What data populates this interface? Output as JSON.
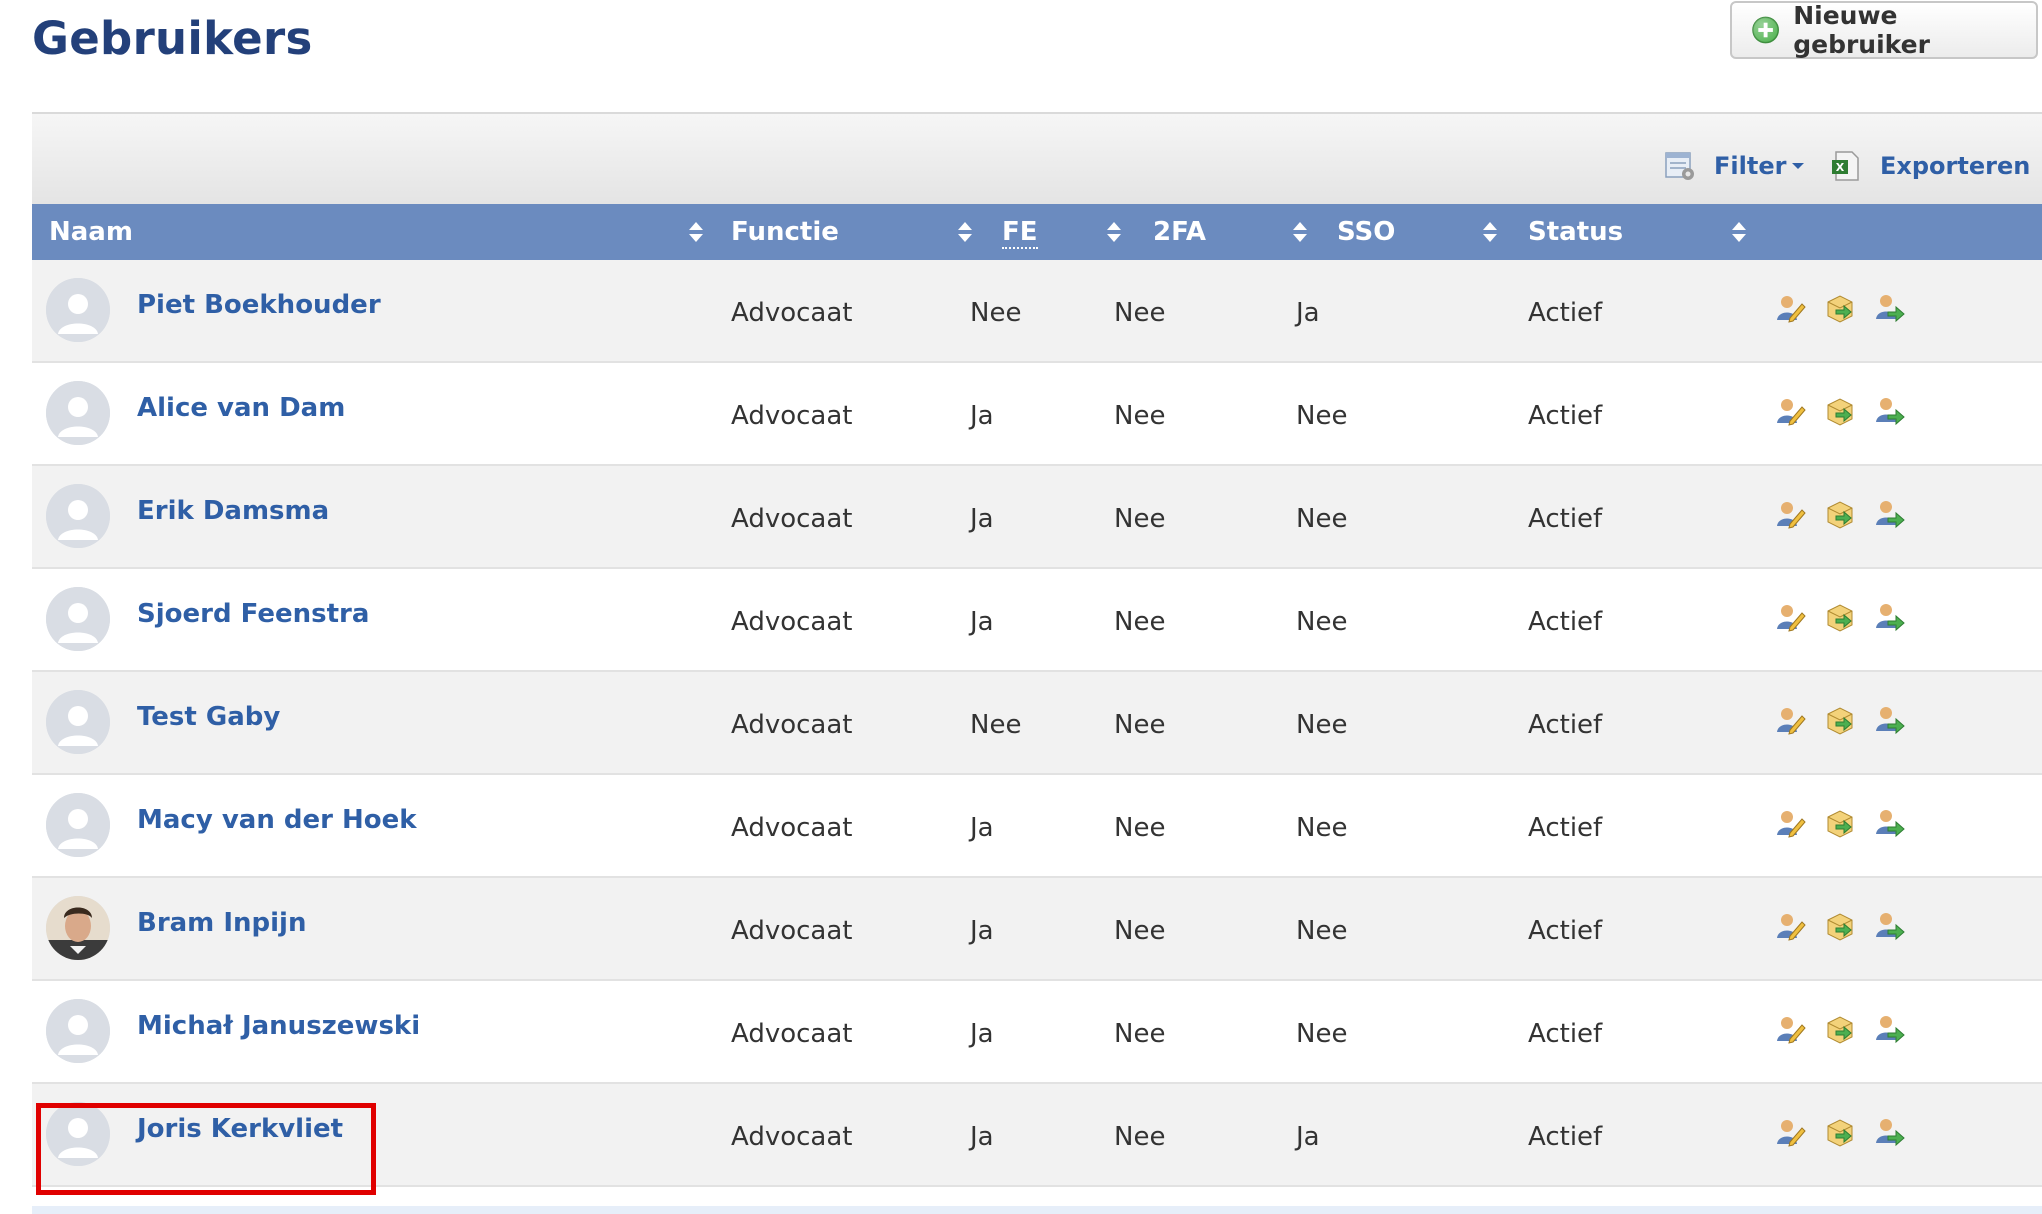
{
  "header": {
    "title": "Gebruikers",
    "new_user_label": "Nieuwe gebruiker"
  },
  "toolbar": {
    "filter_label": "Filter",
    "export_label": "Exporteren"
  },
  "columns": [
    "Naam",
    "Functie",
    "FE",
    "2FA",
    "SSO",
    "Status"
  ],
  "users": [
    {
      "name": "Piet Boekhouder",
      "functie": "Advocaat",
      "fe": "Nee",
      "twofa": "Nee",
      "sso": "Ja",
      "status": "Actief",
      "photo": false
    },
    {
      "name": "Alice van Dam",
      "functie": "Advocaat",
      "fe": "Ja",
      "twofa": "Nee",
      "sso": "Nee",
      "status": "Actief",
      "photo": false
    },
    {
      "name": "Erik Damsma",
      "functie": "Advocaat",
      "fe": "Ja",
      "twofa": "Nee",
      "sso": "Nee",
      "status": "Actief",
      "photo": false
    },
    {
      "name": "Sjoerd Feenstra",
      "functie": "Advocaat",
      "fe": "Ja",
      "twofa": "Nee",
      "sso": "Nee",
      "status": "Actief",
      "photo": false
    },
    {
      "name": "Test Gaby",
      "functie": "Advocaat",
      "fe": "Nee",
      "twofa": "Nee",
      "sso": "Nee",
      "status": "Actief",
      "photo": false
    },
    {
      "name": "Macy van der Hoek",
      "functie": "Advocaat",
      "fe": "Ja",
      "twofa": "Nee",
      "sso": "Nee",
      "status": "Actief",
      "photo": false
    },
    {
      "name": "Bram Inpijn",
      "functie": "Advocaat",
      "fe": "Ja",
      "twofa": "Nee",
      "sso": "Nee",
      "status": "Actief",
      "photo": true
    },
    {
      "name": "Michał Januszewski",
      "functie": "Advocaat",
      "fe": "Ja",
      "twofa": "Nee",
      "sso": "Nee",
      "status": "Actief",
      "photo": false
    },
    {
      "name": "Joris Kerkvliet",
      "functie": "Advocaat",
      "fe": "Ja",
      "twofa": "Nee",
      "sso": "Ja",
      "status": "Actief",
      "photo": false
    }
  ],
  "row_action_icons": [
    "edit-user-icon",
    "export-user-icon",
    "transfer-user-icon"
  ],
  "colors": {
    "title": "#23407a",
    "header_bg": "#6b8bbf",
    "link": "#2f5fa6",
    "highlight": "#e00000"
  }
}
